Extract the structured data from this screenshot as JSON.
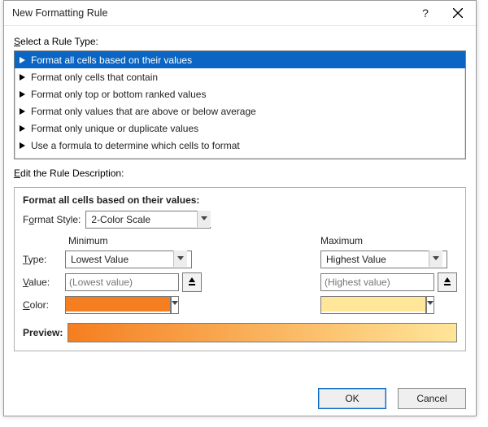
{
  "dialog": {
    "title": "New Formatting Rule",
    "help_icon": "?",
    "close_icon": "×"
  },
  "ruleType": {
    "label_pre": "S",
    "label_post": "elect a Rule Type:",
    "items": [
      "Format all cells based on their values",
      "Format only cells that contain",
      "Format only top or bottom ranked values",
      "Format only values that are above or below average",
      "Format only unique or duplicate values",
      "Use a formula to determine which cells to format"
    ],
    "selected_index": 0
  },
  "editDesc": {
    "label_pre": "E",
    "label_post": "dit the Rule Description:"
  },
  "formatStyle": {
    "heading": "Format all cells based on their values:",
    "label_pre": "F",
    "label_mid": "ormat Style:",
    "value": "2-Color Scale"
  },
  "columns": {
    "min_label": "Minimum",
    "max_label": "Maximum"
  },
  "type": {
    "label_pre": "T",
    "label_post": "ype:",
    "min": "Lowest Value",
    "max": "Highest Value"
  },
  "value": {
    "label_pre": "V",
    "label_post": "alue:",
    "min_placeholder": "(Lowest value)",
    "max_placeholder": "(Highest value)"
  },
  "color": {
    "label_pre": "C",
    "label_post": "olor:",
    "min": "#f57e20",
    "max": "#ffe699"
  },
  "preview": {
    "label": "Preview:"
  },
  "buttons": {
    "ok": "OK",
    "cancel": "Cancel"
  }
}
